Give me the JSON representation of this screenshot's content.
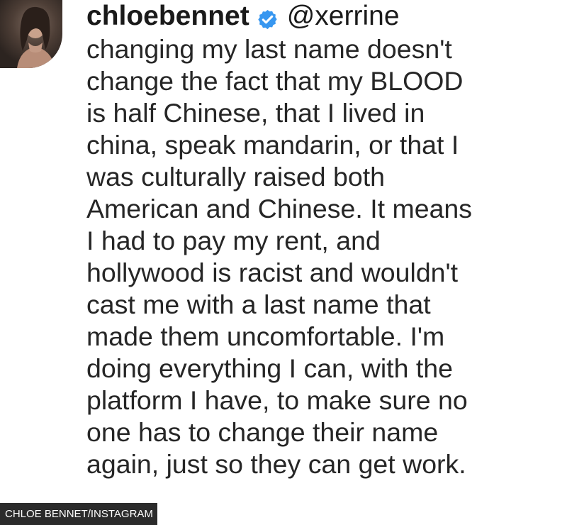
{
  "comment": {
    "avatar_icon": "profile-photo",
    "username": "chloebennet",
    "verified_icon": "verified-badge-icon",
    "verified_color": "#3897f0",
    "mention": "@xerrine",
    "lines": [
      "changing my last name doesn't",
      "change the fact that my BLOOD",
      "is half Chinese, that I lived in",
      "china, speak mandarin, or that I",
      "was culturally raised both",
      "American and Chinese. It means",
      "I had to pay my rent, and",
      "hollywood is racist and wouldn't",
      "cast me with a last name that",
      "made them uncomfortable. I'm",
      "doing everything I can, with the",
      "platform I have, to make sure no",
      "one has to change their name",
      "again, just so they can get work."
    ]
  },
  "caption": {
    "text": "CHLOE BENNET/INSTAGRAM",
    "background": "#2b2b2b"
  }
}
